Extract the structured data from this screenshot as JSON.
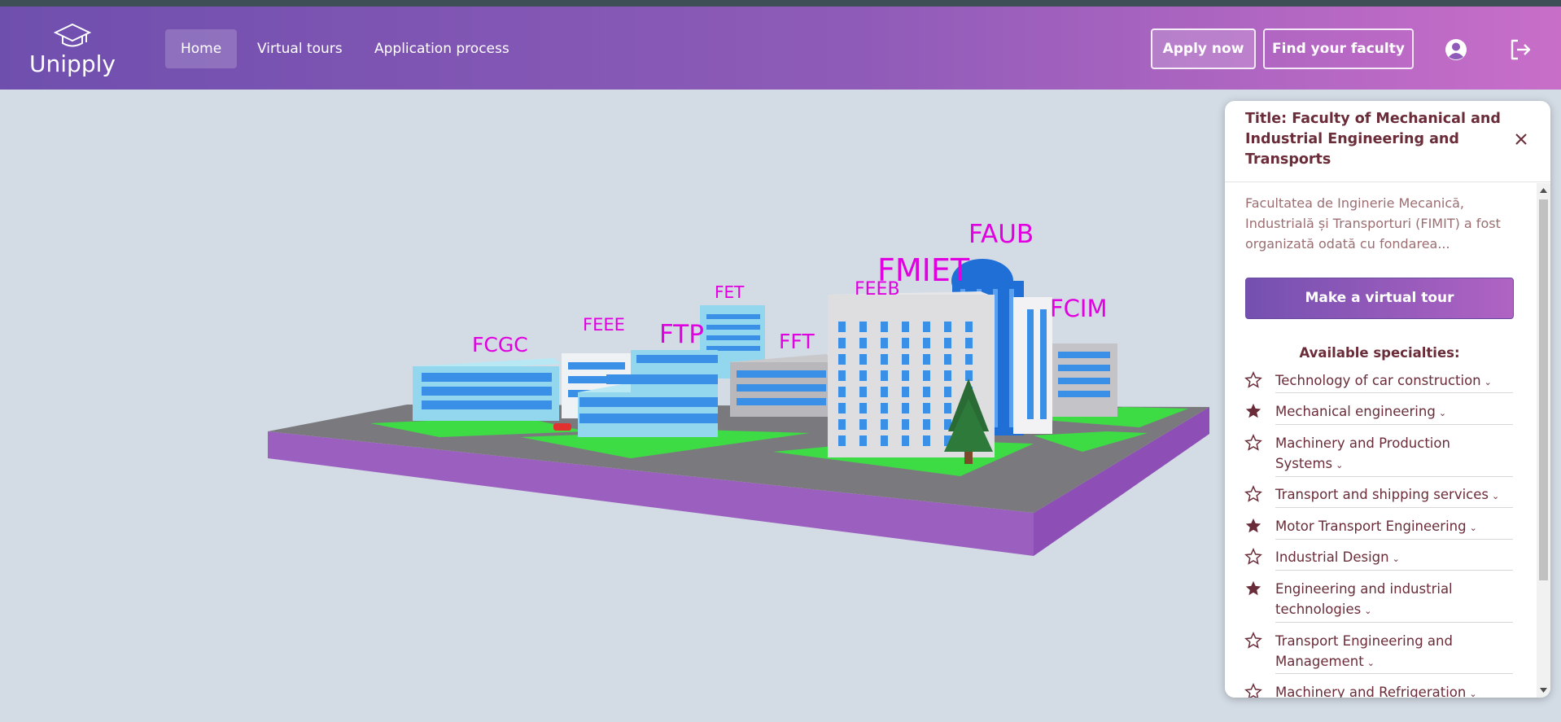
{
  "brand": {
    "name": "Unipply",
    "logo_icon": "graduation-cap-icon"
  },
  "nav": {
    "links": [
      {
        "label": "Home",
        "active": true
      },
      {
        "label": "Virtual tours",
        "active": false
      },
      {
        "label": "Application process",
        "active": false
      }
    ],
    "apply_label": "Apply now",
    "find_label": "Find your faculty",
    "profile_icon": "user-circle-icon",
    "logout_icon": "logout-icon"
  },
  "scene": {
    "labels": [
      "FAUB",
      "FMIET",
      "FEEB",
      "FET",
      "FTP",
      "FEEE",
      "FCGC",
      "FFT",
      "FCIM"
    ]
  },
  "panel": {
    "title": "Title: Faculty of Mechanical and Industrial Engineering and Transports",
    "description": "Facultatea de Inginerie Mecanică, Industrială și Transporturi (FIMIT) a fost organizată odată cu fondarea...",
    "tour_button": "Make a virtual tour",
    "specialties_heading": "Available specialties:",
    "specialties": [
      {
        "name": "Technology of car construction",
        "starred": false
      },
      {
        "name": "Mechanical engineering",
        "starred": true
      },
      {
        "name": "Machinery and Production Systems",
        "starred": false
      },
      {
        "name": "Transport and shipping services",
        "starred": false
      },
      {
        "name": "Motor Transport Engineering",
        "starred": true
      },
      {
        "name": "Industrial Design",
        "starred": false
      },
      {
        "name": "Engineering and industrial technologies",
        "starred": true
      },
      {
        "name": "Transport Engineering and Management",
        "starred": false
      },
      {
        "name": "Machinery and Refrigeration",
        "starred": false
      }
    ]
  },
  "colors": {
    "brand_gradient_start": "#6f4fae",
    "brand_gradient_end": "#c86ec9",
    "accent_text": "#6a2c38",
    "scene_label": "#e000e0"
  }
}
